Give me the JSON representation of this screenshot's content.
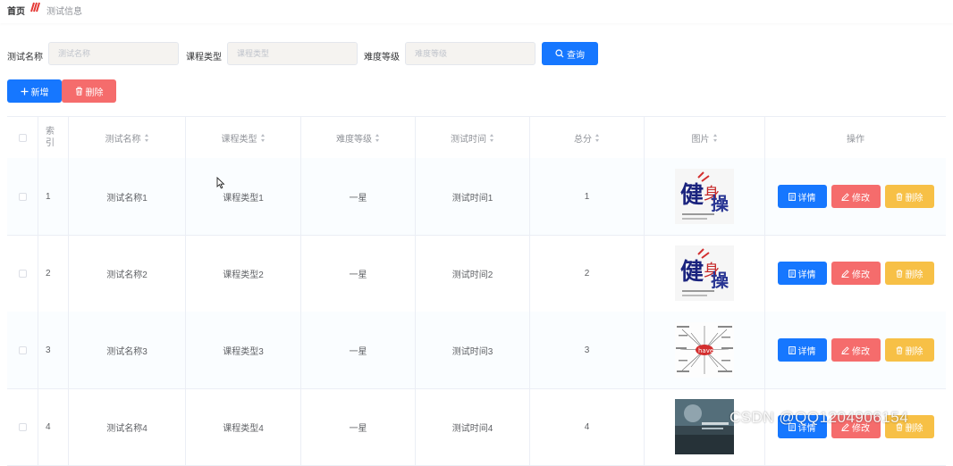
{
  "breadcrumb": {
    "home": "首页",
    "current": "测试信息"
  },
  "search": {
    "fields": [
      {
        "label": "测试名称",
        "placeholder": "测试名称",
        "value": ""
      },
      {
        "label": "课程类型",
        "placeholder": "课程类型",
        "value": ""
      },
      {
        "label": "难度等级",
        "placeholder": "难度等级",
        "value": ""
      }
    ],
    "button_label": "查询"
  },
  "toolbar": {
    "add_label": "新增",
    "delete_label": "删除"
  },
  "table": {
    "columns": [
      "索引",
      "测试名称",
      "课程类型",
      "难度等级",
      "测试时间",
      "总分",
      "图片",
      "操作"
    ],
    "rows": [
      {
        "index": "1",
        "name": "测试名称1",
        "type": "课程类型1",
        "level": "一星",
        "time": "测试时间1",
        "score": "1",
        "image": "fitness-poster"
      },
      {
        "index": "2",
        "name": "测试名称2",
        "type": "课程类型2",
        "level": "一星",
        "time": "测试时间2",
        "score": "2",
        "image": "fitness-poster"
      },
      {
        "index": "3",
        "name": "测试名称3",
        "type": "课程类型3",
        "level": "一星",
        "time": "测试时间3",
        "score": "3",
        "image": "have-mindmap"
      },
      {
        "index": "4",
        "name": "测试名称4",
        "type": "课程类型4",
        "level": "一星",
        "time": "测试时间4",
        "score": "4",
        "image": "blue-poster"
      }
    ],
    "actions": {
      "detail": "详情",
      "edit": "修改",
      "remove": "删除"
    }
  },
  "watermark": "CSDN @QQ1204906154",
  "colors": {
    "primary": "#1677ff",
    "danger": "#f56c6c",
    "warning": "#f7c046"
  }
}
